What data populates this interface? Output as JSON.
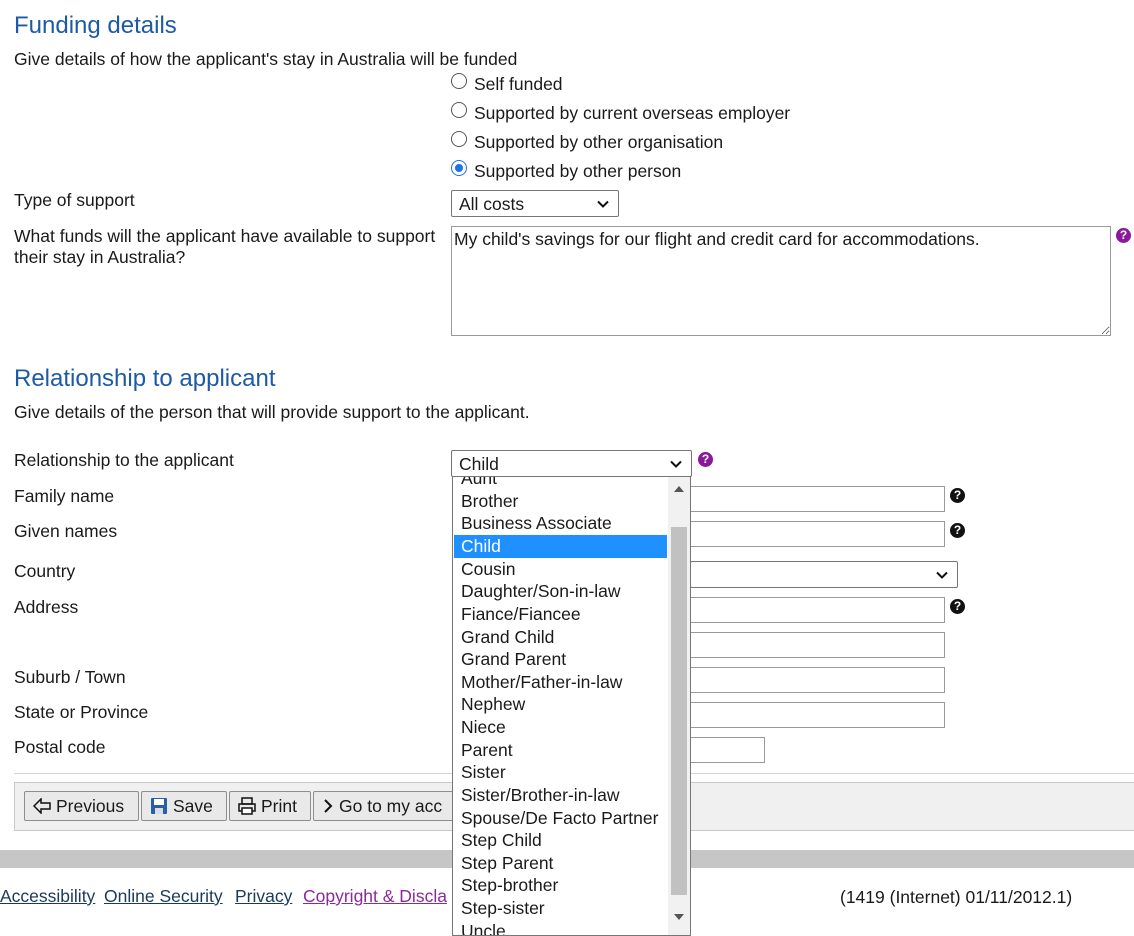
{
  "funding": {
    "heading": "Funding details",
    "intro": "Give details of how the applicant's stay in Australia will be funded",
    "options": [
      {
        "label": "Self funded",
        "checked": false
      },
      {
        "label": "Supported by current overseas employer",
        "checked": false
      },
      {
        "label": "Supported by other organisation",
        "checked": false
      },
      {
        "label": "Supported by other person",
        "checked": true
      }
    ],
    "type_label": "Type of support",
    "type_value": "All costs",
    "funds_label_1": "What funds will the applicant have available to support",
    "funds_label_2": "their stay in Australia?",
    "funds_value": "My child's savings for our flight and credit card for accommodations."
  },
  "relationship": {
    "heading": "Relationship to applicant",
    "intro": "Give details of the person that will provide support to the applicant.",
    "rel_label": "Relationship to the applicant",
    "rel_value": "Child",
    "family_name_label": "Family name",
    "given_names_label": "Given names",
    "country_label": "Country",
    "address_label": "Address",
    "suburb_label": "Suburb / Town",
    "state_label": "State or Province",
    "postal_label": "Postal code"
  },
  "dropdown": {
    "options": [
      "Aunt",
      "Brother",
      "Business Associate",
      "Child",
      "Cousin",
      "Daughter/Son-in-law",
      "Fiance/Fiancee",
      "Grand Child",
      "Grand Parent",
      "Mother/Father-in-law",
      "Nephew",
      "Niece",
      "Parent",
      "Sister",
      "Sister/Brother-in-law",
      "Spouse/De Facto Partner",
      "Step Child",
      "Step Parent",
      "Step-brother",
      "Step-sister",
      "Uncle"
    ],
    "selected": "Child"
  },
  "buttons": {
    "previous": "Previous",
    "save": "Save",
    "print": "Print",
    "goto": "Go to my acc"
  },
  "footer": {
    "accessibility": "Accessibility",
    "security": "Online Security",
    "privacy": "Privacy",
    "copyright": "Copyright & Discla",
    "version": "(1419 (Internet) 01/11/2012.1)"
  },
  "colors": {
    "heading": "#1d5aa5",
    "selected_option": "#1e90ff",
    "help_purple": "#8b1a9a",
    "radio_checked": "#1a73e8"
  },
  "icons": [
    "help-icon",
    "chevron-down-icon",
    "arrow-left-icon",
    "save-icon",
    "print-icon",
    "chevron-right-icon"
  ]
}
